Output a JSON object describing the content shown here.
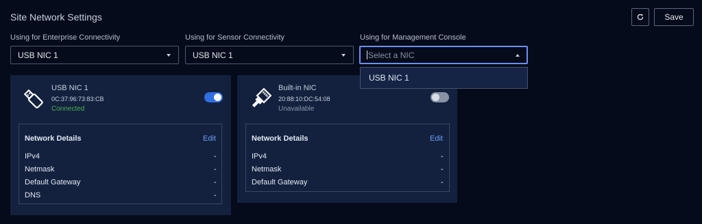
{
  "header": {
    "title": "Site Network Settings",
    "save_label": "Save"
  },
  "selects": [
    {
      "label": "Using for Enterprise Connectivity",
      "value": "USB NIC 1"
    },
    {
      "label": "Using for Sensor Connectivity",
      "value": "USB NIC 1"
    },
    {
      "label": "Using for Management Console",
      "placeholder": "Select a NIC"
    }
  ],
  "dropdown": {
    "options": [
      "USB NIC 1"
    ]
  },
  "cards": [
    {
      "name": "USB NIC 1",
      "mac": "0C:37:96:73:83:CB",
      "status": "Connected",
      "status_color": "#4caf50",
      "enabled": true,
      "details_title": "Network Details",
      "edit_label": "Edit",
      "rows": [
        {
          "label": "IPv4",
          "value": "-"
        },
        {
          "label": "Netmask",
          "value": "-"
        },
        {
          "label": "Default Gateway",
          "value": "-"
        },
        {
          "label": "DNS",
          "value": "-"
        }
      ]
    },
    {
      "name": "Built-in NIC",
      "mac": "20:88:10:DC:54:08",
      "status": "Unavailable",
      "status_color": "#8e97a8",
      "enabled": false,
      "details_title": "Network Details",
      "edit_label": "Edit",
      "rows": [
        {
          "label": "IPv4",
          "value": "-"
        },
        {
          "label": "Netmask",
          "value": "-"
        },
        {
          "label": "Default Gateway",
          "value": "-"
        }
      ]
    }
  ],
  "colors": {
    "background": "#050b1a",
    "card": "#13213f",
    "accent": "#2f6fe4",
    "link": "#6f9cf4",
    "focus_border": "#6e8ff5"
  }
}
